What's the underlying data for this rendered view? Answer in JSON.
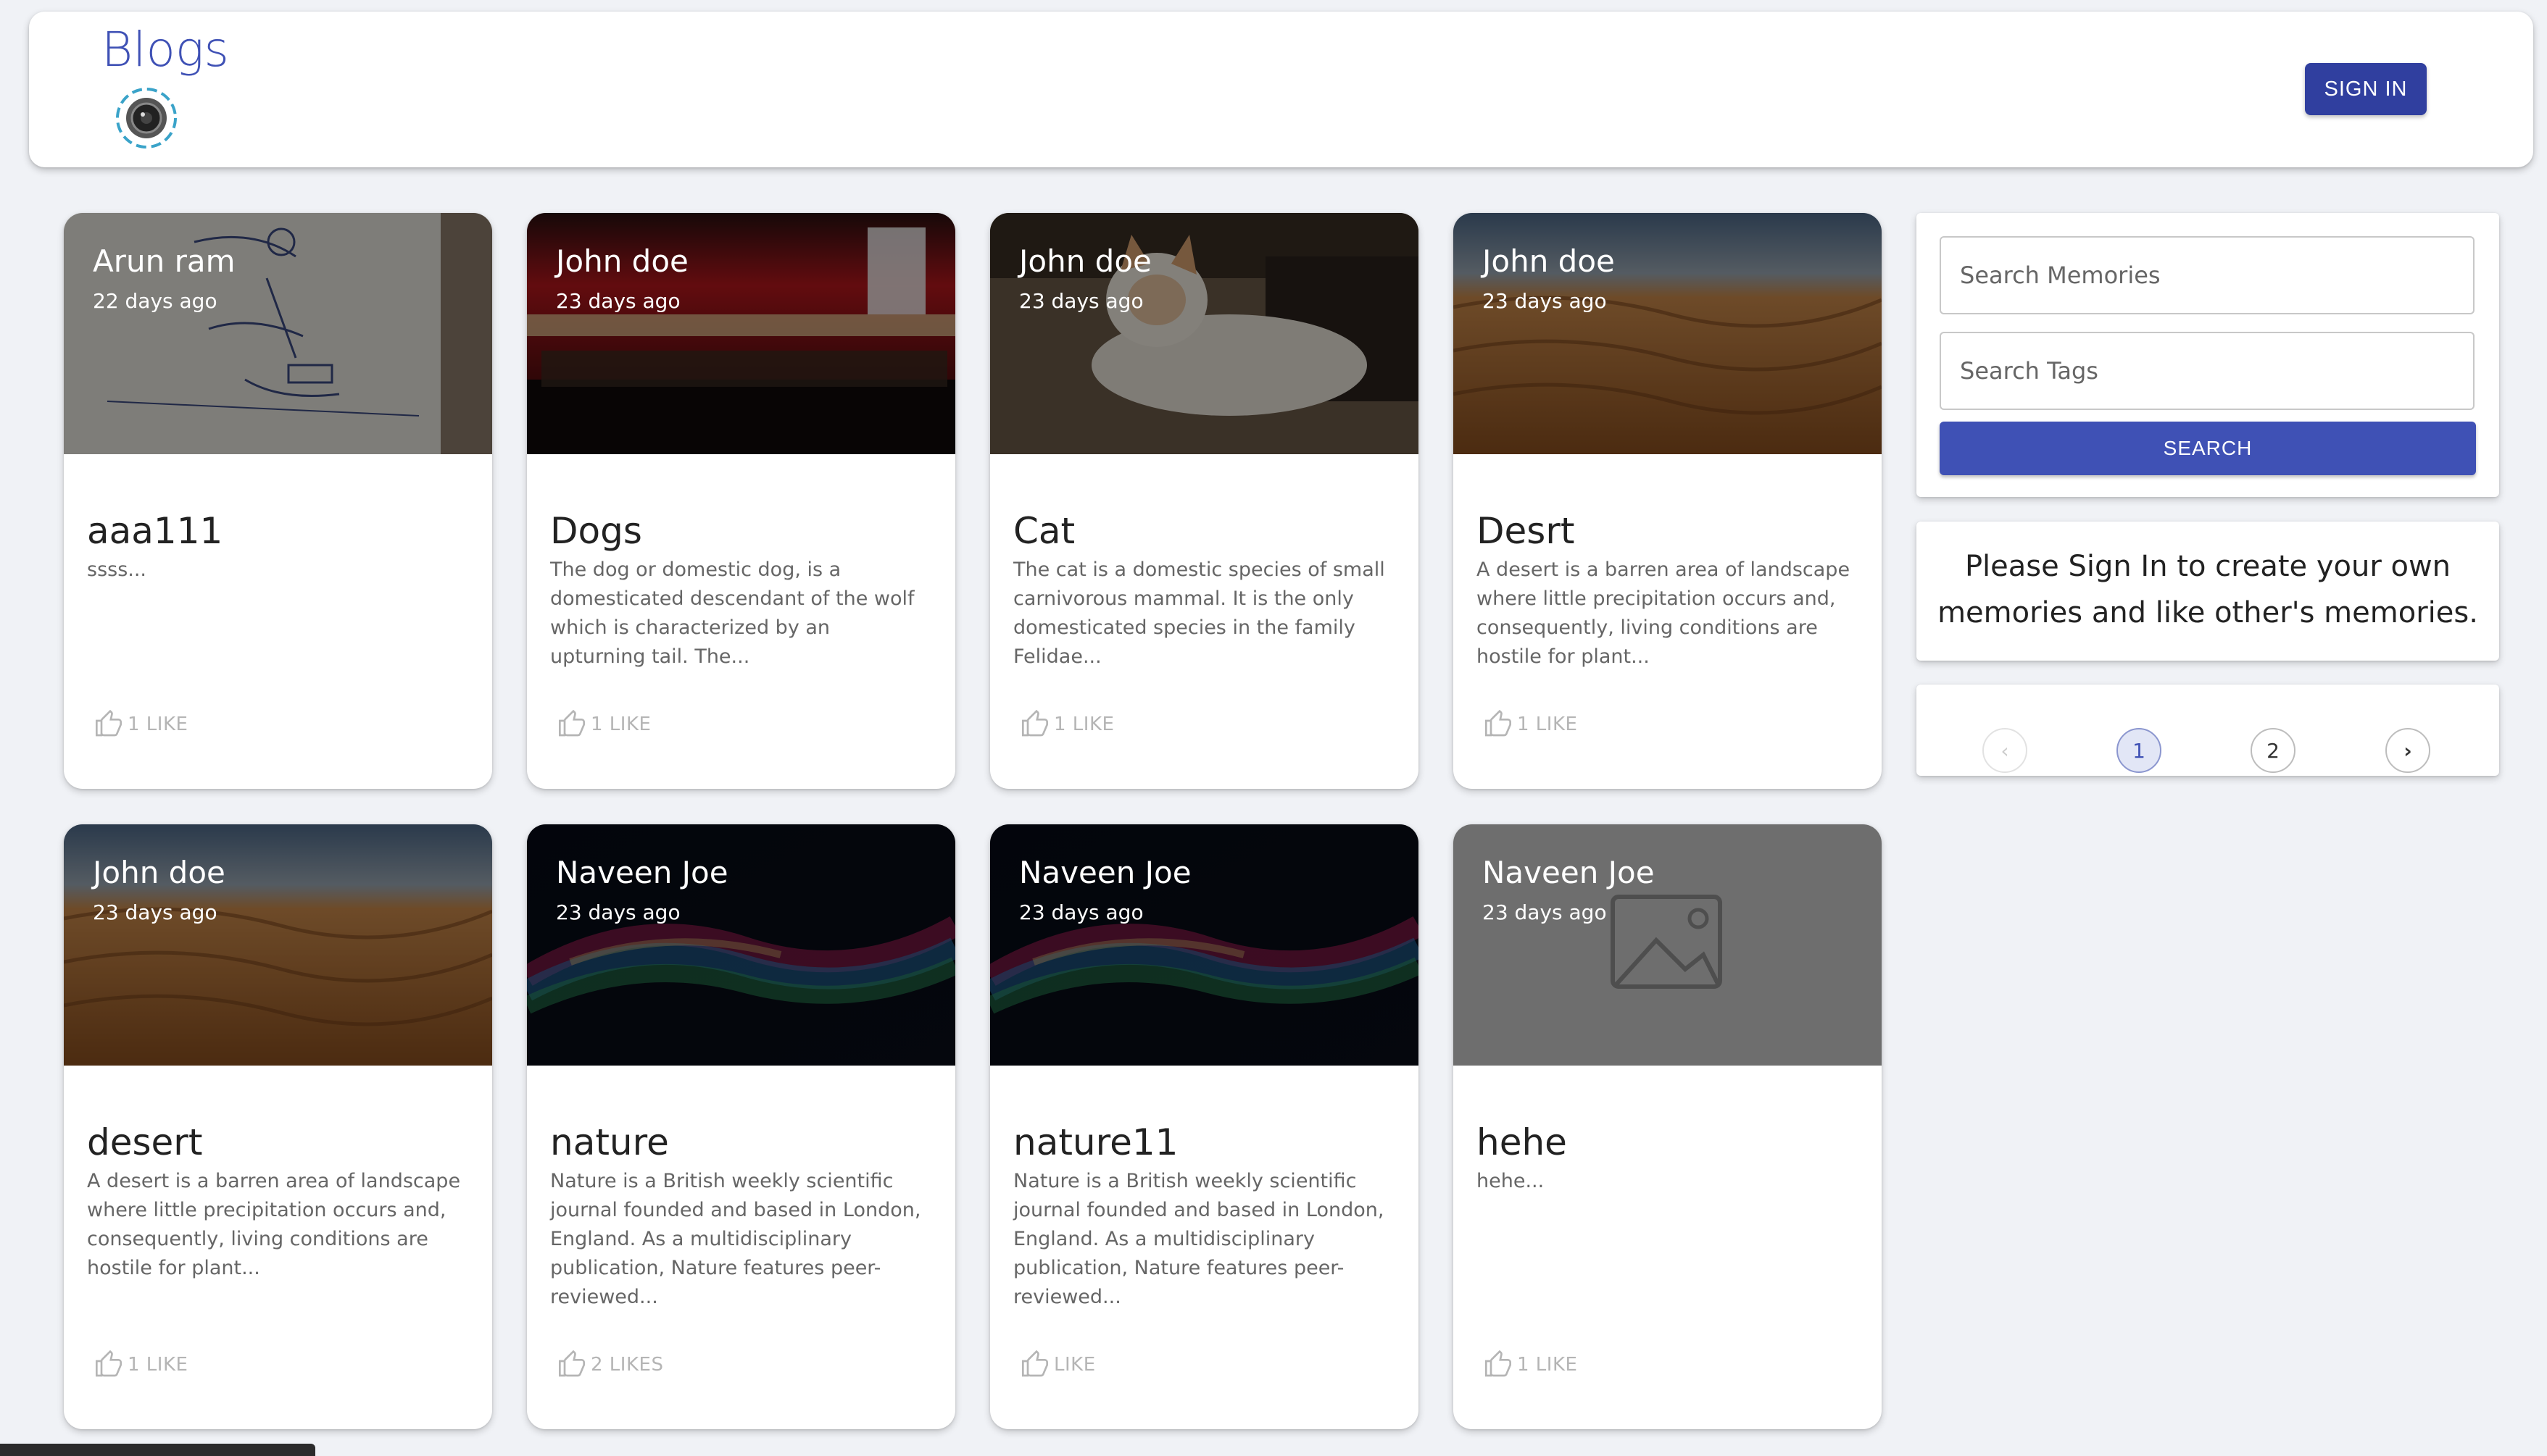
{
  "header": {
    "brand": "Blogs",
    "sign_in_label": "SIGN IN"
  },
  "posts": [
    {
      "author": "Arun ram",
      "date": "22 days ago",
      "title": "aaa111",
      "excerpt": "ssss...",
      "likes": "1 LIKE",
      "image": "notebook-sketch"
    },
    {
      "author": "John doe",
      "date": "23 days ago",
      "title": "Dogs",
      "excerpt": "The dog or domestic dog, is a domesticated descendant of the wolf which is characterized by an upturning tail. The...",
      "likes": "1 LIKE",
      "image": "store-front"
    },
    {
      "author": "John doe",
      "date": "23 days ago",
      "title": "Cat",
      "excerpt": "The cat is a domestic species of small carnivorous mammal. It is the only domesticated species in the family Felidae...",
      "likes": "1 LIKE",
      "image": "cat"
    },
    {
      "author": "John doe",
      "date": "23 days ago",
      "title": "Desrt",
      "excerpt": "A desert is a barren area of landscape where little precipitation occurs and, consequently, living conditions are hostile for plant...",
      "likes": "1 LIKE",
      "image": "desert"
    },
    {
      "author": "John doe",
      "date": "23 days ago",
      "title": "desert",
      "excerpt": "A desert is a barren area of landscape where little precipitation occurs and, consequently, living conditions are hostile for plant...",
      "likes": "1 LIKE",
      "image": "desert"
    },
    {
      "author": "Naveen Joe",
      "date": "23 days ago",
      "title": "nature",
      "excerpt": "Nature is a British weekly scientific journal founded and based in London, England. As a multidisciplinary publication, Nature features peer-reviewed...",
      "likes": "2 LIKES",
      "image": "nebula"
    },
    {
      "author": "Naveen Joe",
      "date": "23 days ago",
      "title": "nature11",
      "excerpt": "Nature is a British weekly scientific journal founded and based in London, England. As a multidisciplinary publication, Nature features peer-reviewed...",
      "likes": "LIKE",
      "image": "nebula"
    },
    {
      "author": "Naveen Joe",
      "date": "23 days ago",
      "title": "hehe",
      "excerpt": "hehe...",
      "likes": "1 LIKE",
      "image": "placeholder"
    }
  ],
  "sidebar": {
    "search_memories_placeholder": "Search Memories",
    "search_tags_placeholder": "Search Tags",
    "search_label": "SEARCH",
    "signin_message": "Please Sign In to create your own memories and like other's memories.",
    "pagination": {
      "prev_icon": "chevron-left-icon",
      "pages": [
        "1",
        "2"
      ],
      "current": "1",
      "next_icon": "chevron-right-icon"
    }
  },
  "colors": {
    "primary": "#3f51b5",
    "primary_dark": "#303f9f",
    "background": "#f0f2f6"
  }
}
